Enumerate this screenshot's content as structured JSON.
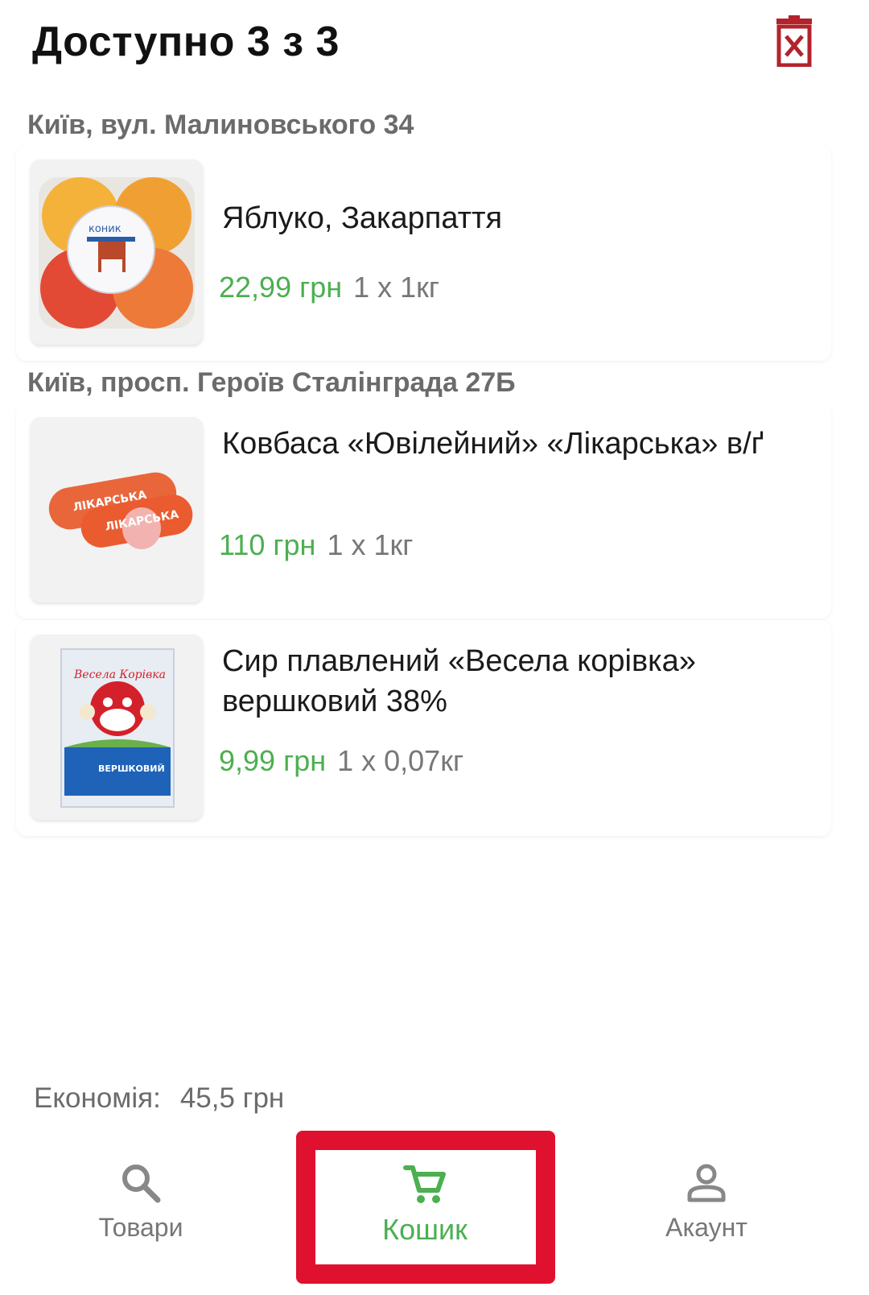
{
  "header": {
    "title": "Доступно 3 з 3"
  },
  "stores": [
    {
      "label": "Київ, вул. Малиновського 34",
      "items": [
        {
          "name": "Яблуко, Закарпаття",
          "price": "22,99 грн",
          "qty": "1 x 1кг",
          "image": "apples"
        }
      ]
    },
    {
      "label": "Київ, просп. Героїв Сталінграда 27Б",
      "items": [
        {
          "name": "Ковбаса «Ювілейний» «Лікарська» в/ґ",
          "price": "110 грн",
          "qty": "1 x 1кг",
          "image": "sausage"
        },
        {
          "name": "Сир плавлений «Весела корівка» вершковий 38%",
          "price": "9,99 грн",
          "qty": "1 x 0,07кг",
          "image": "cheese"
        }
      ]
    }
  ],
  "summary": {
    "savings_label": "Економія:",
    "savings_value": "45,5 грн"
  },
  "nav": [
    {
      "label": "Товари",
      "icon": "search-icon"
    },
    {
      "label": "Кошик",
      "icon": "cart-icon",
      "active": true
    },
    {
      "label": "Акаунт",
      "icon": "account-icon"
    }
  ],
  "colors": {
    "accent": "#4caf50",
    "danger": "#b3232c",
    "highlight": "#e0102f"
  }
}
